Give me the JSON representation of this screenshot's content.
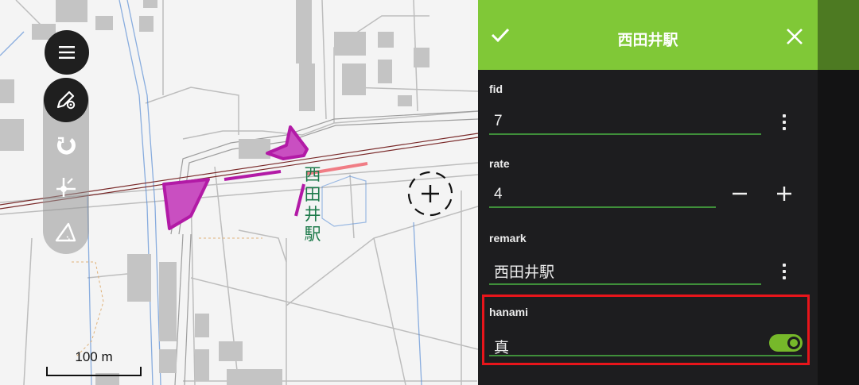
{
  "map": {
    "station_label_chars": [
      "西",
      "田",
      "井",
      "駅"
    ],
    "scale_label": "100 m",
    "colors": {
      "background": "#f4f4f4",
      "road": "#bdbdbd",
      "building": "#c4c4c4",
      "water": "#5b8fd6",
      "railway": "#7a2a2a",
      "feature_fill": "#c94fc1",
      "feature_stroke": "#b21aa6",
      "platform_highlight": "#f07d85",
      "label_green": "#1d7a4a"
    },
    "icons": {
      "menu": "hamburger-menu-icon",
      "digitize": "pencil-gear-icon",
      "snap": "magnet-icon",
      "vertex": "vertex-edit-icon",
      "measure": "measure-triangle-icon",
      "crosshair": "crosshair-icon"
    }
  },
  "form": {
    "title": "西田井駅",
    "colors": {
      "header": "#80c837",
      "panel": "#1d1d1f",
      "accent": "#76b82a",
      "highlight": "#e8151b"
    },
    "fields": {
      "fid": {
        "label": "fid",
        "value": "7"
      },
      "rate": {
        "label": "rate",
        "value": "4"
      },
      "remark": {
        "label": "remark",
        "value": "西田井駅"
      },
      "hanami": {
        "label": "hanami",
        "value": "真",
        "toggle_on": true
      }
    }
  }
}
